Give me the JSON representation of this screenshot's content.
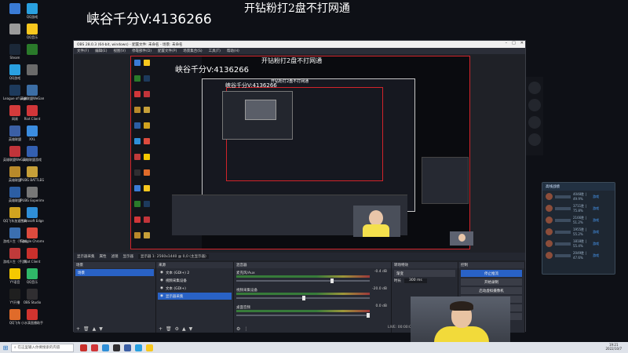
{
  "overlay": {
    "title_left": "峡谷千分V:4136266",
    "title_right": "开钻粉打2盘不打网通"
  },
  "desktop": {
    "icons": [
      {
        "label": "",
        "icon": "pc-icon",
        "color": "#3a7bd5"
      },
      {
        "label": "QQ游戏",
        "icon": "game-icon",
        "color": "#29a0e0"
      },
      {
        "label": "",
        "icon": "folder-icon",
        "color": "#9a9a9a"
      },
      {
        "label": "QQ音乐",
        "icon": "music-icon",
        "color": "#f7c71e"
      },
      {
        "label": "Steam",
        "icon": "steam-icon",
        "color": "#1b2838"
      },
      {
        "label": "",
        "icon": "app-icon",
        "color": "#2a7a2a"
      },
      {
        "label": "QQ游戏",
        "icon": "game-icon",
        "color": "#29a0e0"
      },
      {
        "label": "",
        "icon": "app-icon",
        "color": "#6a6a6a"
      },
      {
        "label": "League of Legends",
        "icon": "lol-icon",
        "color": "#1d3a5c"
      },
      {
        "label": "英雄联盟WeGame版",
        "icon": "lol-icon",
        "color": "#3c6ea5"
      },
      {
        "label": "网易",
        "icon": "app-icon",
        "color": "#d43b3b"
      },
      {
        "label": "Riot Client",
        "icon": "riot-icon",
        "color": "#d13639"
      },
      {
        "label": "英雄联盟",
        "icon": "lol-icon",
        "color": "#3b5fa5"
      },
      {
        "label": "XXL",
        "icon": "app-icon",
        "color": "#3b8de0"
      },
      {
        "label": "英雄联盟WeGame",
        "icon": "lol-icon",
        "color": "#c1343a"
      },
      {
        "label": "英雄联盟游戏",
        "icon": "lol-icon",
        "color": "#335fb0"
      },
      {
        "label": "英雄联盟",
        "icon": "lol-icon",
        "color": "#b8892a"
      },
      {
        "label": "PUBG BATTLEGR...",
        "icon": "pubg-icon",
        "color": "#c7a039"
      },
      {
        "label": "英雄联盟",
        "icon": "lol-icon",
        "color": "#2c5ea3"
      },
      {
        "label": "PUBG Experime...",
        "icon": "pubg-icon",
        "color": "#777777"
      },
      {
        "label": "QQ飞车加速工具",
        "icon": "app-icon",
        "color": "#d1a31f"
      },
      {
        "label": "Microsoft Edge",
        "icon": "edge-icon",
        "color": "#2f8fd8"
      },
      {
        "label": "游戏人生（手游版）",
        "icon": "app-icon",
        "color": "#3b6fb0"
      },
      {
        "label": "Google Chrome",
        "icon": "chrome-icon",
        "color": "#dd4b3e"
      },
      {
        "label": "游戏人生（手游版）",
        "icon": "app-icon",
        "color": "#c03a3a"
      },
      {
        "label": "Riot Client",
        "icon": "riot-icon",
        "color": "#c9302c"
      },
      {
        "label": "YY语音",
        "icon": "app-icon",
        "color": "#f5c800"
      },
      {
        "label": "QQ音乐",
        "icon": "music-icon",
        "color": "#2fb868"
      },
      {
        "label": "YY开播",
        "icon": "app-icon",
        "color": "#1f1f1f"
      },
      {
        "label": "OBS Studio",
        "icon": "obs-icon",
        "color": "#302e31"
      },
      {
        "label": "QQ飞车",
        "icon": "app-icon",
        "color": "#e06b2a"
      },
      {
        "label": "小水滴直播助手",
        "icon": "app-icon",
        "color": "#d1342f"
      }
    ]
  },
  "obs": {
    "window_title": "OBS 28.0.3 (64-bit, windows) - 配置文件: 未命名 - 场景: 未命名",
    "menu": [
      "文件(F)",
      "编辑(E)",
      "视图(V)",
      "停靠部件(D)",
      "配置文件(P)",
      "场景集合(S)",
      "工具(T)",
      "帮助(H)"
    ],
    "controls_bar": {
      "source_name": "显示器采集",
      "props": "属性",
      "filters": "滤镜",
      "display": "显示器",
      "display_value": "显示器 1: 2560x1440 @ 0,0 (主显示器)"
    },
    "docks": {
      "scenes": {
        "title": "场景",
        "items": [
          "场景"
        ]
      },
      "sources": {
        "title": "来源",
        "items": [
          "文本 (GDI+) 2",
          "视频采集设备",
          "文本 (GDI+)",
          "显示器采集"
        ]
      },
      "mixer": {
        "title": "混音器",
        "tracks": [
          {
            "name": "麦克风/Aux",
            "db": "-0.4 dB"
          },
          {
            "name": "视频采集设备",
            "db": "-20.0 dB"
          },
          {
            "name": "桌面音频",
            "db": "0.0 dB"
          }
        ]
      },
      "transitions": {
        "title": "转场特效",
        "type": "渐变",
        "duration_label": "时长",
        "duration": "300 ms"
      },
      "controls": {
        "title": "控制",
        "buttons": [
          "停止推流",
          "开始录制",
          "启动虚拟摄像机",
          "工作室模式",
          "设置",
          "退出"
        ]
      }
    },
    "status": "LIVE: 00:00:00"
  },
  "side_panel": {
    "title": "高线战绩",
    "rows": [
      {
        "value": "4048胜 | 49.9%",
        "link": "游戏"
      },
      {
        "value": "3711胜 | 75.8%",
        "link": "游戏"
      },
      {
        "value": "2166胜 | 51.2%",
        "link": "游戏"
      },
      {
        "value": "1955胜 | 55.2%",
        "link": "游戏"
      },
      {
        "value": "1818胜 | 55.4%",
        "link": "游戏"
      },
      {
        "value": "2049胜 | 47.6%",
        "link": "游戏"
      }
    ]
  },
  "taskbar": {
    "search_placeholder": "在这里输入你要搜索的内容",
    "time": "19:21",
    "date": "2022/10/7"
  }
}
